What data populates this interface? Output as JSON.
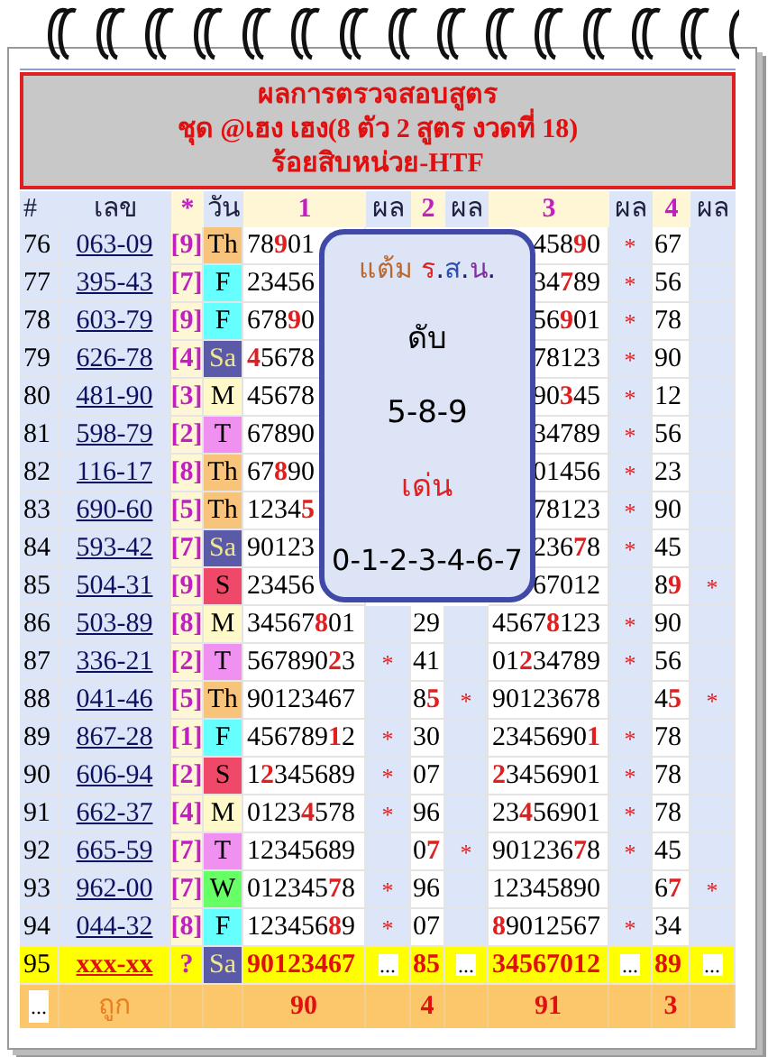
{
  "title": [
    "ผลการตรวจสอบสูตร",
    "ชุด @เฮง เฮง(8 ตัว 2 สูตร งวดที่ 18)",
    "ร้อยสิบหน่วย-HTF"
  ],
  "columns": [
    {
      "text": "#",
      "kind": "label"
    },
    {
      "text": "เลข",
      "kind": "label"
    },
    {
      "text": "*",
      "kind": "marker"
    },
    {
      "text": "วัน",
      "kind": "label"
    },
    {
      "text": "1",
      "kind": "marker"
    },
    {
      "text": "ผล",
      "kind": "label"
    },
    {
      "text": "2",
      "kind": "marker"
    },
    {
      "text": "ผล",
      "kind": "label"
    },
    {
      "text": "3",
      "kind": "marker"
    },
    {
      "text": "ผล",
      "kind": "label"
    },
    {
      "text": "4",
      "kind": "marker"
    },
    {
      "text": "ผล",
      "kind": "label"
    }
  ],
  "rows": [
    {
      "kind": "result",
      "num": "76",
      "code": "063-09",
      "bracket": "[9]",
      "day": "Th",
      "color": "#f8c47c",
      "c1": "78**9**01",
      "c3": "458**9**0",
      "r3": "*",
      "c4": "67"
    },
    {
      "kind": "result",
      "num": "77",
      "code": "395-43",
      "bracket": "[7]",
      "day": "F",
      "color": "#66ffff",
      "c1": "23456",
      "c3": "34**7**89",
      "r3": "*",
      "c4": "56"
    },
    {
      "kind": "result",
      "num": "78",
      "code": "603-79",
      "bracket": "[9]",
      "day": "F",
      "color": "#66ffff",
      "c1": "678**9**0",
      "c3": "56**9**01",
      "r3": "*",
      "c4": "78"
    },
    {
      "kind": "result",
      "num": "79",
      "code": "626-78",
      "bracket": "[4]",
      "day": "Sa",
      "color": "#5a5aa8",
      "c1": "**4**5678",
      "c3": "78123",
      "r3": "*",
      "c4": "90"
    },
    {
      "kind": "result",
      "num": "80",
      "code": "481-90",
      "bracket": "[3]",
      "day": "M",
      "color": "#fff8c8",
      "c1": "45678",
      "c3": "90**3**45",
      "r3": "*",
      "c4": "12"
    },
    {
      "kind": "result",
      "num": "81",
      "code": "598-79",
      "bracket": "[2]",
      "day": "T",
      "color": "#f090f0",
      "c1": "67890",
      "c3": "34789",
      "r3": "*",
      "c4": "56"
    },
    {
      "kind": "result",
      "num": "82",
      "code": "116-17",
      "bracket": "[8]",
      "day": "Th",
      "color": "#f8c47c",
      "c1": "67**8**90",
      "c3": "01456",
      "r3": "*",
      "c4": "23"
    },
    {
      "kind": "result",
      "num": "83",
      "code": "690-60",
      "bracket": "[5]",
      "day": "Th",
      "color": "#f8c47c",
      "c1": "1234**5**",
      "c3": "78123",
      "r3": "*",
      "c4": "90"
    },
    {
      "kind": "result",
      "num": "84",
      "code": "593-42",
      "bracket": "[7]",
      "day": "Sa",
      "color": "#5a5aa8",
      "c1": "90123",
      "c3": "236**7**8",
      "r3": "*",
      "c4": "45"
    },
    {
      "kind": "result",
      "num": "85",
      "code": "504-31",
      "bracket": "[9]",
      "day": "S",
      "color": "#f04868",
      "c1": "23456",
      "c3": "67012",
      "c4": "8**9**",
      "r4": "*"
    },
    {
      "kind": "result",
      "num": "86",
      "code": "503-89",
      "bracket": "[8]",
      "day": "M",
      "color": "#fff8c8",
      "c1": "34567**8**01",
      "c2": "29",
      "c3": "4567**8**123",
      "r3": "*",
      "c4": "90"
    },
    {
      "kind": "result",
      "num": "87",
      "code": "336-21",
      "bracket": "[2]",
      "day": "T",
      "color": "#f090f0",
      "c1": "567890**2**3",
      "r1": "*",
      "c2": "41",
      "c3": "01**2**34789",
      "r3": "*",
      "c4": "56"
    },
    {
      "kind": "result",
      "num": "88",
      "code": "041-46",
      "bracket": "[5]",
      "day": "Th",
      "color": "#f8c47c",
      "c1": "90123467",
      "c2": "8**5**",
      "r2": "*",
      "c3": "90123678",
      "c4": "4**5**",
      "r4": "*"
    },
    {
      "kind": "result",
      "num": "89",
      "code": "867-28",
      "bracket": "[1]",
      "day": "F",
      "color": "#66ffff",
      "c1": "456789**1**2",
      "r1": "*",
      "c2": "30",
      "c3": "2345690**1**",
      "r3": "*",
      "c4": "78"
    },
    {
      "kind": "result",
      "num": "90",
      "code": "606-94",
      "bracket": "[2]",
      "day": "S",
      "color": "#f04868",
      "c1": "1**2**345689",
      "r1": "*",
      "c2": "07",
      "c3": "**2**3456901",
      "r3": "*",
      "c4": "78"
    },
    {
      "kind": "result",
      "num": "91",
      "code": "662-37",
      "bracket": "[4]",
      "day": "M",
      "color": "#fff8c8",
      "c1": "0123**4**578",
      "r1": "*",
      "c2": "96",
      "c3": "23**4**56901",
      "r3": "*",
      "c4": "78"
    },
    {
      "kind": "result",
      "num": "92",
      "code": "665-59",
      "bracket": "[7]",
      "day": "T",
      "color": "#f090f0",
      "c1": "12345689",
      "c2": "0**7**",
      "r2": "*",
      "c3": "901236**7**8",
      "r3": "*",
      "c4": "45"
    },
    {
      "kind": "result",
      "num": "93",
      "code": "962-00",
      "bracket": "[7]",
      "day": "W",
      "color": "#66ff66",
      "c1": "012345**7**8",
      "r1": "*",
      "c2": "96",
      "c3": "12345890",
      "c4": "6**7**",
      "r4": "*"
    },
    {
      "kind": "result",
      "num": "94",
      "code": "044-32",
      "bracket": "[8]",
      "day": "F",
      "color": "#66ffff",
      "c1": "123456**8**9",
      "r1": "*",
      "c2": "07",
      "c3": "**8**9012567",
      "r3": "*",
      "c4": "34"
    },
    {
      "kind": "pending",
      "num": "95",
      "code": "xxx-xx",
      "bracket": "?",
      "day": "Sa",
      "color": "#5a5aa8",
      "c1": "90123467",
      "r1": "...",
      "c2": "85",
      "r2": "...",
      "c3": "34567012",
      "r3": "...",
      "c4": "89",
      "r4": "..."
    }
  ],
  "totals": {
    "more": "...",
    "label": "ถูก",
    "c1": "90",
    "c2": "4",
    "c3": "91",
    "c4": "3"
  },
  "popup": {
    "heading": "แต้ม",
    "letters": [
      {
        "text": "ร",
        "color": "#e02020"
      },
      {
        "text": ".",
        "color": "#202060"
      },
      {
        "text": "ส",
        "color": "#3050b0"
      },
      {
        "text": ".",
        "color": "#202060"
      },
      {
        "text": "น",
        "color": "#8030a0"
      },
      {
        "text": ".",
        "color": "#202060"
      }
    ],
    "dead_label": "ดับ",
    "dead": "5-8-9",
    "strong_label": "เด่น",
    "strong": "0-1-2-3-4-6-7"
  }
}
